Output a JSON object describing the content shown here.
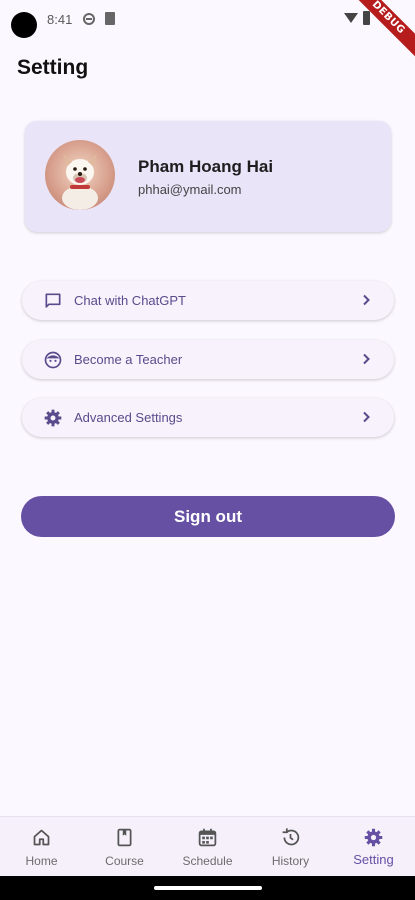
{
  "status_bar": {
    "time": "8:41",
    "debug_label": "DEBUG"
  },
  "page": {
    "title": "Setting"
  },
  "profile": {
    "name": "Pham Hoang Hai",
    "email": "phhai@ymail.com"
  },
  "menu": [
    {
      "label": "Chat with ChatGPT",
      "icon": "chat-icon"
    },
    {
      "label": "Become a Teacher",
      "icon": "face-icon"
    },
    {
      "label": "Advanced Settings",
      "icon": "gear-icon"
    }
  ],
  "signout_label": "Sign out",
  "nav": [
    {
      "label": "Home",
      "icon": "home-icon",
      "active": false
    },
    {
      "label": "Course",
      "icon": "book-icon",
      "active": false
    },
    {
      "label": "Schedule",
      "icon": "calendar-icon",
      "active": false
    },
    {
      "label": "History",
      "icon": "history-icon",
      "active": false
    },
    {
      "label": "Setting",
      "icon": "gear-icon",
      "active": true
    }
  ],
  "colors": {
    "accent": "#6650a4",
    "background": "#fcf8ff",
    "card": "#e9e4f8"
  }
}
